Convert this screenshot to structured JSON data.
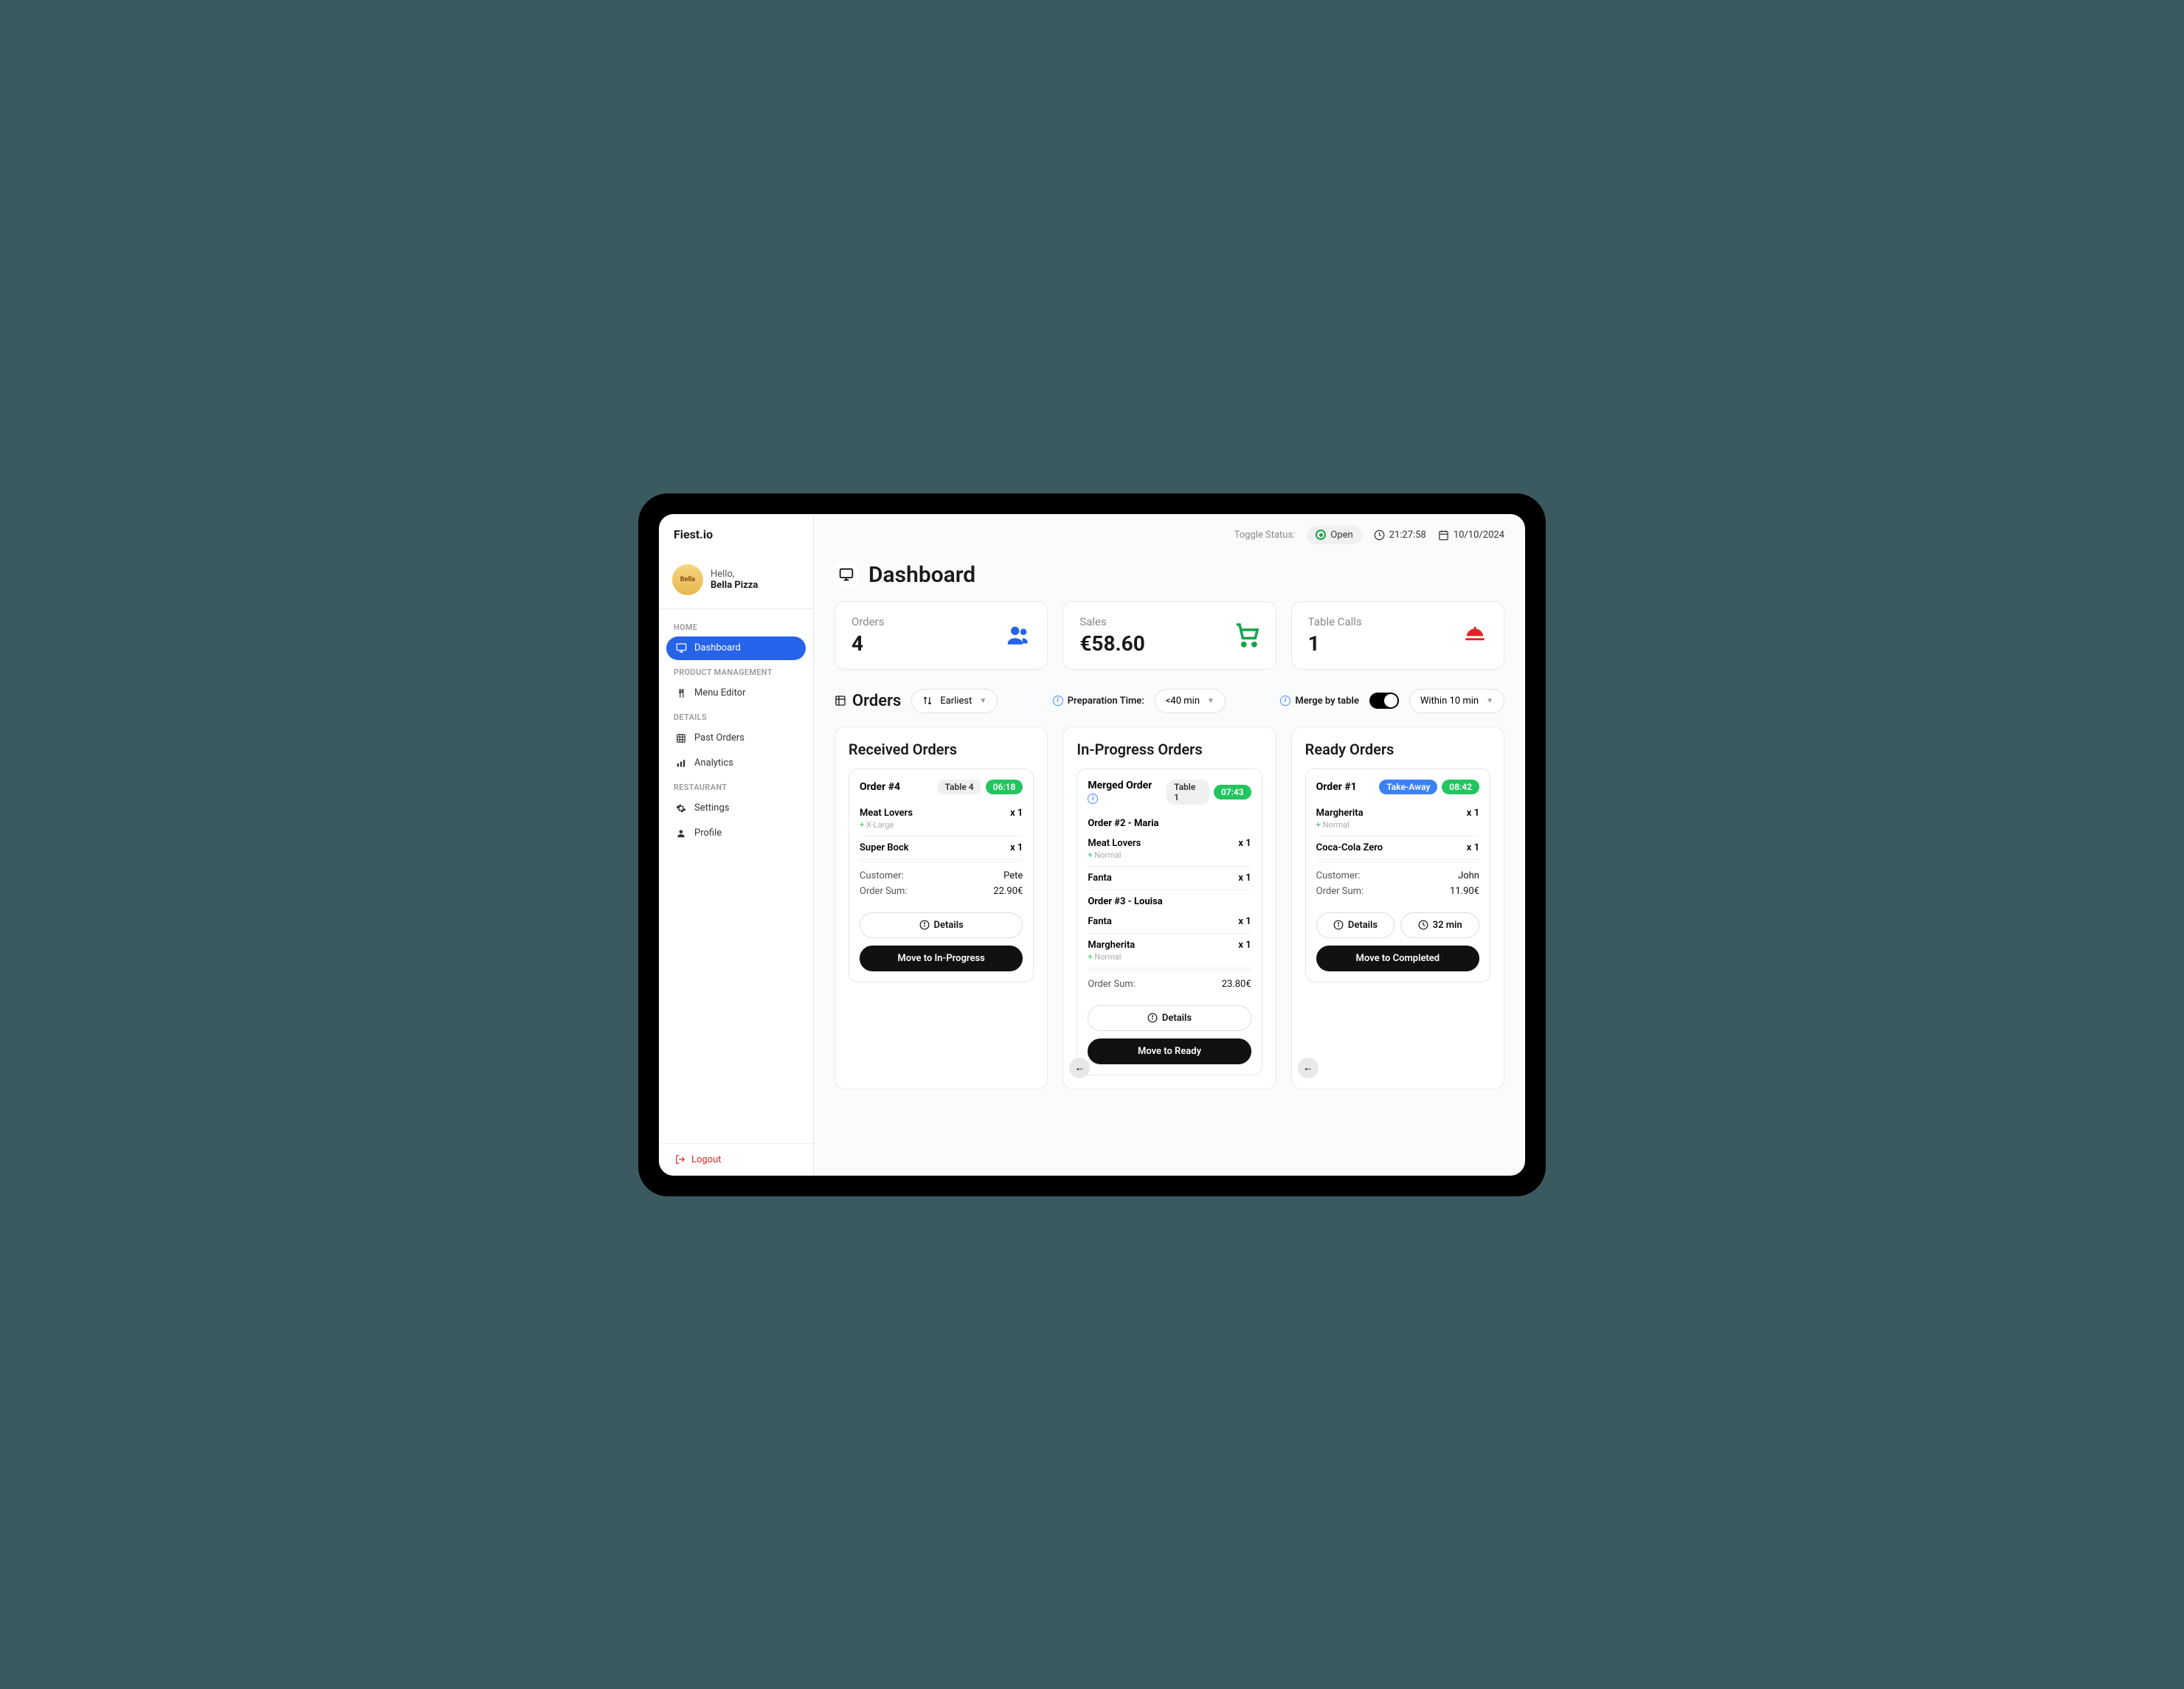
{
  "brand": "Fiest.io",
  "user": {
    "greeting": "Hello,",
    "name": "Bella Pizza",
    "avatar_text": "Bella"
  },
  "nav": {
    "sections": [
      {
        "header": "HOME",
        "items": [
          {
            "label": "Dashboard",
            "icon": "monitor",
            "active": true
          }
        ]
      },
      {
        "header": "PRODUCT MANAGEMENT",
        "items": [
          {
            "label": "Menu Editor",
            "icon": "utensils",
            "active": false
          }
        ]
      },
      {
        "header": "DETAILS",
        "items": [
          {
            "label": "Past Orders",
            "icon": "grid",
            "active": false
          },
          {
            "label": "Analytics",
            "icon": "bar-chart",
            "active": false
          }
        ]
      },
      {
        "header": "RESTAURANT",
        "items": [
          {
            "label": "Settings",
            "icon": "gear",
            "active": false
          },
          {
            "label": "Profile",
            "icon": "person",
            "active": false
          }
        ]
      }
    ]
  },
  "logout_label": "Logout",
  "topbar": {
    "toggle_label": "Toggle Status:",
    "status": "Open",
    "time": "21:27:58",
    "date": "10/10/2024"
  },
  "page": {
    "title": "Dashboard"
  },
  "stats": {
    "orders": {
      "label": "Orders",
      "value": "4"
    },
    "sales": {
      "label": "Sales",
      "value": "€58.60"
    },
    "table_calls": {
      "label": "Table Calls",
      "value": "1"
    }
  },
  "controls": {
    "orders_label": "Orders",
    "sort_value": "Earliest",
    "prep_label": "Preparation Time:",
    "prep_value": "<40 min",
    "merge_label": "Merge by table",
    "within_value": "Within 10 min"
  },
  "columns": {
    "received": {
      "title": "Received Orders",
      "card": {
        "id": "Order #4",
        "table": "Table 4",
        "time": "06:18",
        "items": [
          {
            "name": "Meat Lovers",
            "qty": "x 1",
            "sub": "X-Large"
          },
          {
            "name": "Super Bock",
            "qty": "x 1"
          }
        ],
        "customer_label": "Customer:",
        "customer": "Pete",
        "sum_label": "Order Sum:",
        "sum": "22.90€",
        "details_btn": "Details",
        "action_btn": "Move to In-Progress"
      }
    },
    "inprogress": {
      "title": "In-Progress Orders",
      "card": {
        "id": "Merged Order",
        "table": "Table 1",
        "time": "07:43",
        "sub_orders": [
          {
            "header": "Order #2 - Maria",
            "items": [
              {
                "name": "Meat Lovers",
                "qty": "x 1",
                "sub": "Normal"
              },
              {
                "name": "Fanta",
                "qty": "x 1"
              }
            ]
          },
          {
            "header": "Order #3 - Louisa",
            "items": [
              {
                "name": "Fanta",
                "qty": "x 1"
              },
              {
                "name": "Margherita",
                "qty": "x 1",
                "sub": "Normal"
              }
            ]
          }
        ],
        "sum_label": "Order Sum:",
        "sum": "23.80€",
        "details_btn": "Details",
        "action_btn": "Move to Ready"
      }
    },
    "ready": {
      "title": "Ready Orders",
      "card": {
        "id": "Order #1",
        "tag": "Take-Away",
        "time": "08:42",
        "items": [
          {
            "name": "Margherita",
            "qty": "x 1",
            "sub": "Normal"
          },
          {
            "name": "Coca-Cola Zero",
            "qty": "x 1"
          }
        ],
        "customer_label": "Customer:",
        "customer": "John",
        "sum_label": "Order Sum:",
        "sum": "11.90€",
        "details_btn": "Details",
        "timer": "32 min",
        "action_btn": "Move to Completed"
      }
    }
  }
}
